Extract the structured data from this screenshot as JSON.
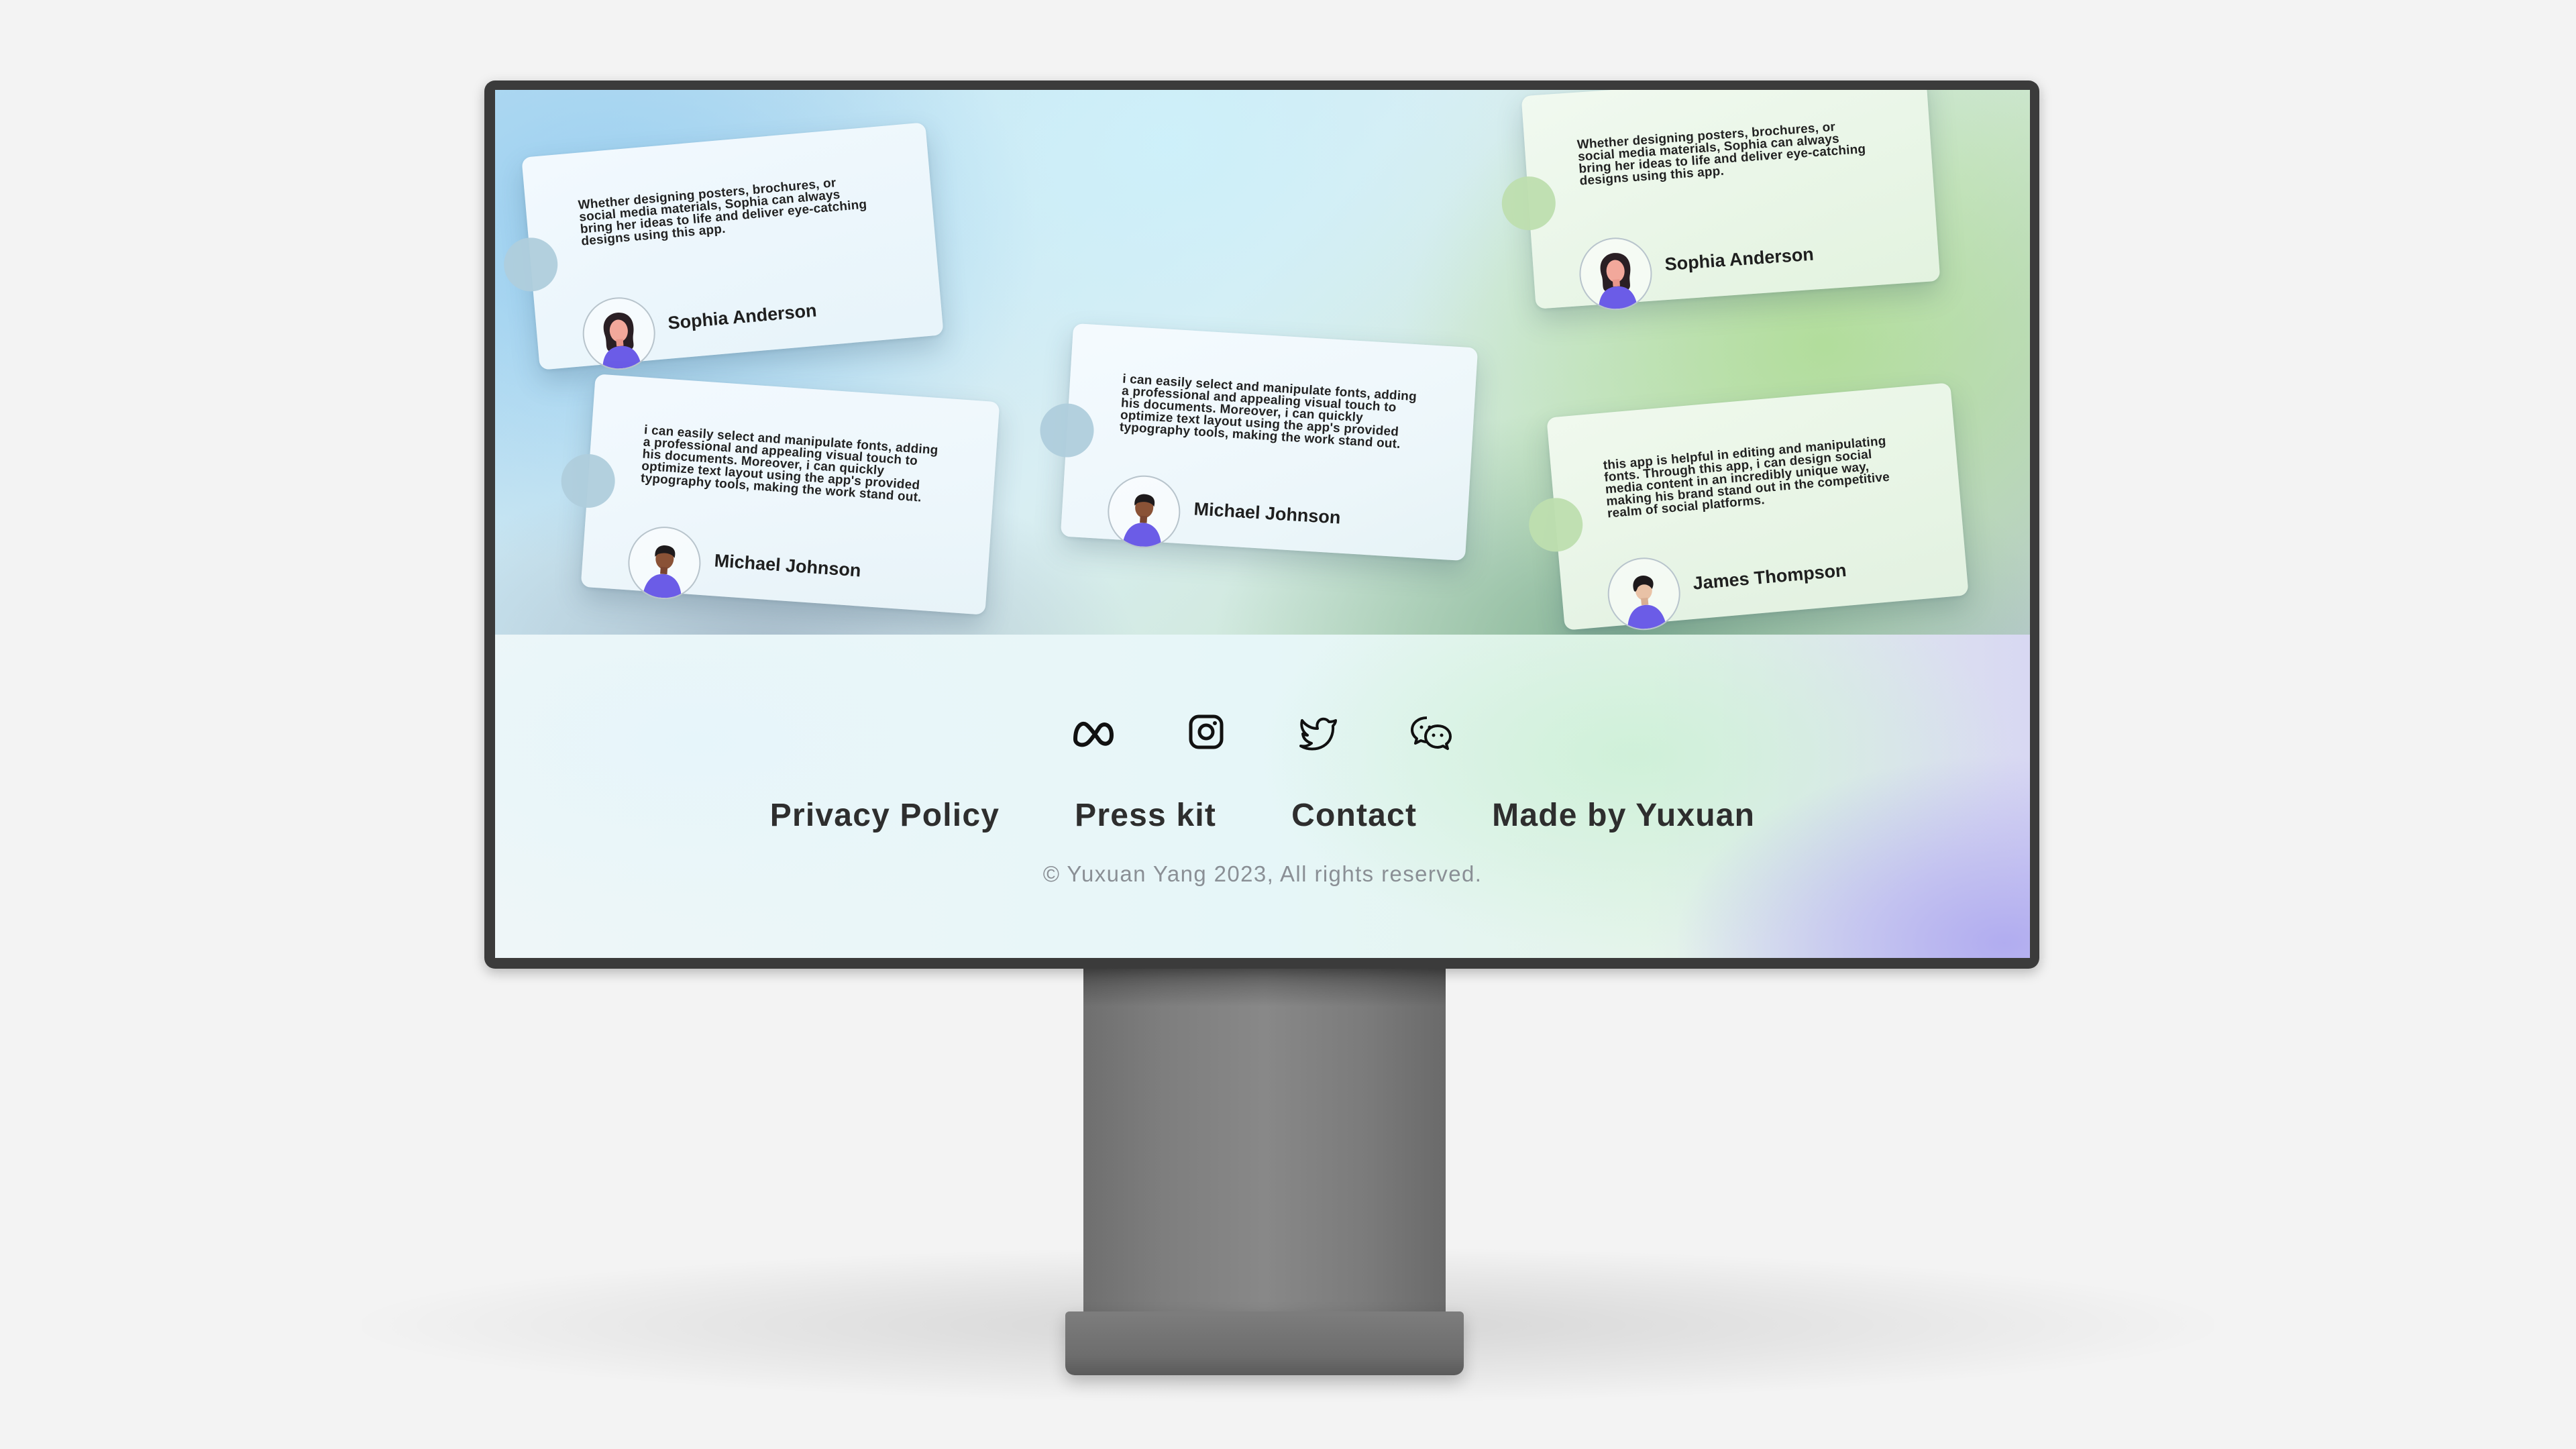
{
  "testimonials": [
    {
      "text": "Whether designing posters, brochures, or social media materials, Sophia can always bring her ideas to life and deliver eye-catching designs using this app.",
      "name": "Sophia Anderson",
      "avatar": "woman-avatar-icon"
    },
    {
      "text": "i can easily select and manipulate fonts, adding a professional and appealing visual touch to his documents. Moreover, i can quickly optimize text layout using the app's provided typography tools, making the work stand out.",
      "name": "Michael Johnson",
      "avatar": "man-avatar-icon"
    },
    {
      "text": "i can easily select and manipulate fonts, adding a professional and appealing visual touch to his documents. Moreover, i can quickly optimize text layout using the app's provided typography tools, making the work stand out.",
      "name": "Michael Johnson",
      "avatar": "man-avatar-icon"
    },
    {
      "text": "Whether designing posters, brochures, or social media materials, Sophia can always bring her ideas to life and deliver eye-catching designs using this app.",
      "name": "Sophia Anderson",
      "avatar": "woman-avatar-icon"
    },
    {
      "text": "this app is helpful in editing and manipulating fonts. Through this app, i can design social media content in an incredibly unique way, making his brand stand out in the competitive realm of social platforms.",
      "name": "James Thompson",
      "avatar": "man-avatar-icon"
    }
  ],
  "footer": {
    "social": [
      "meta-icon",
      "instagram-icon",
      "twitter-icon",
      "wechat-icon"
    ],
    "links": [
      "Privacy Policy",
      "Press kit",
      "Contact",
      "Made by Yuxuan"
    ],
    "copyright": "© Yuxuan Yang 2023, All rights reserved."
  },
  "colors": {
    "avatar_shirt": "#6b5ce7",
    "link_text": "#2e2e2e",
    "copyright_text": "#8a8f95"
  }
}
